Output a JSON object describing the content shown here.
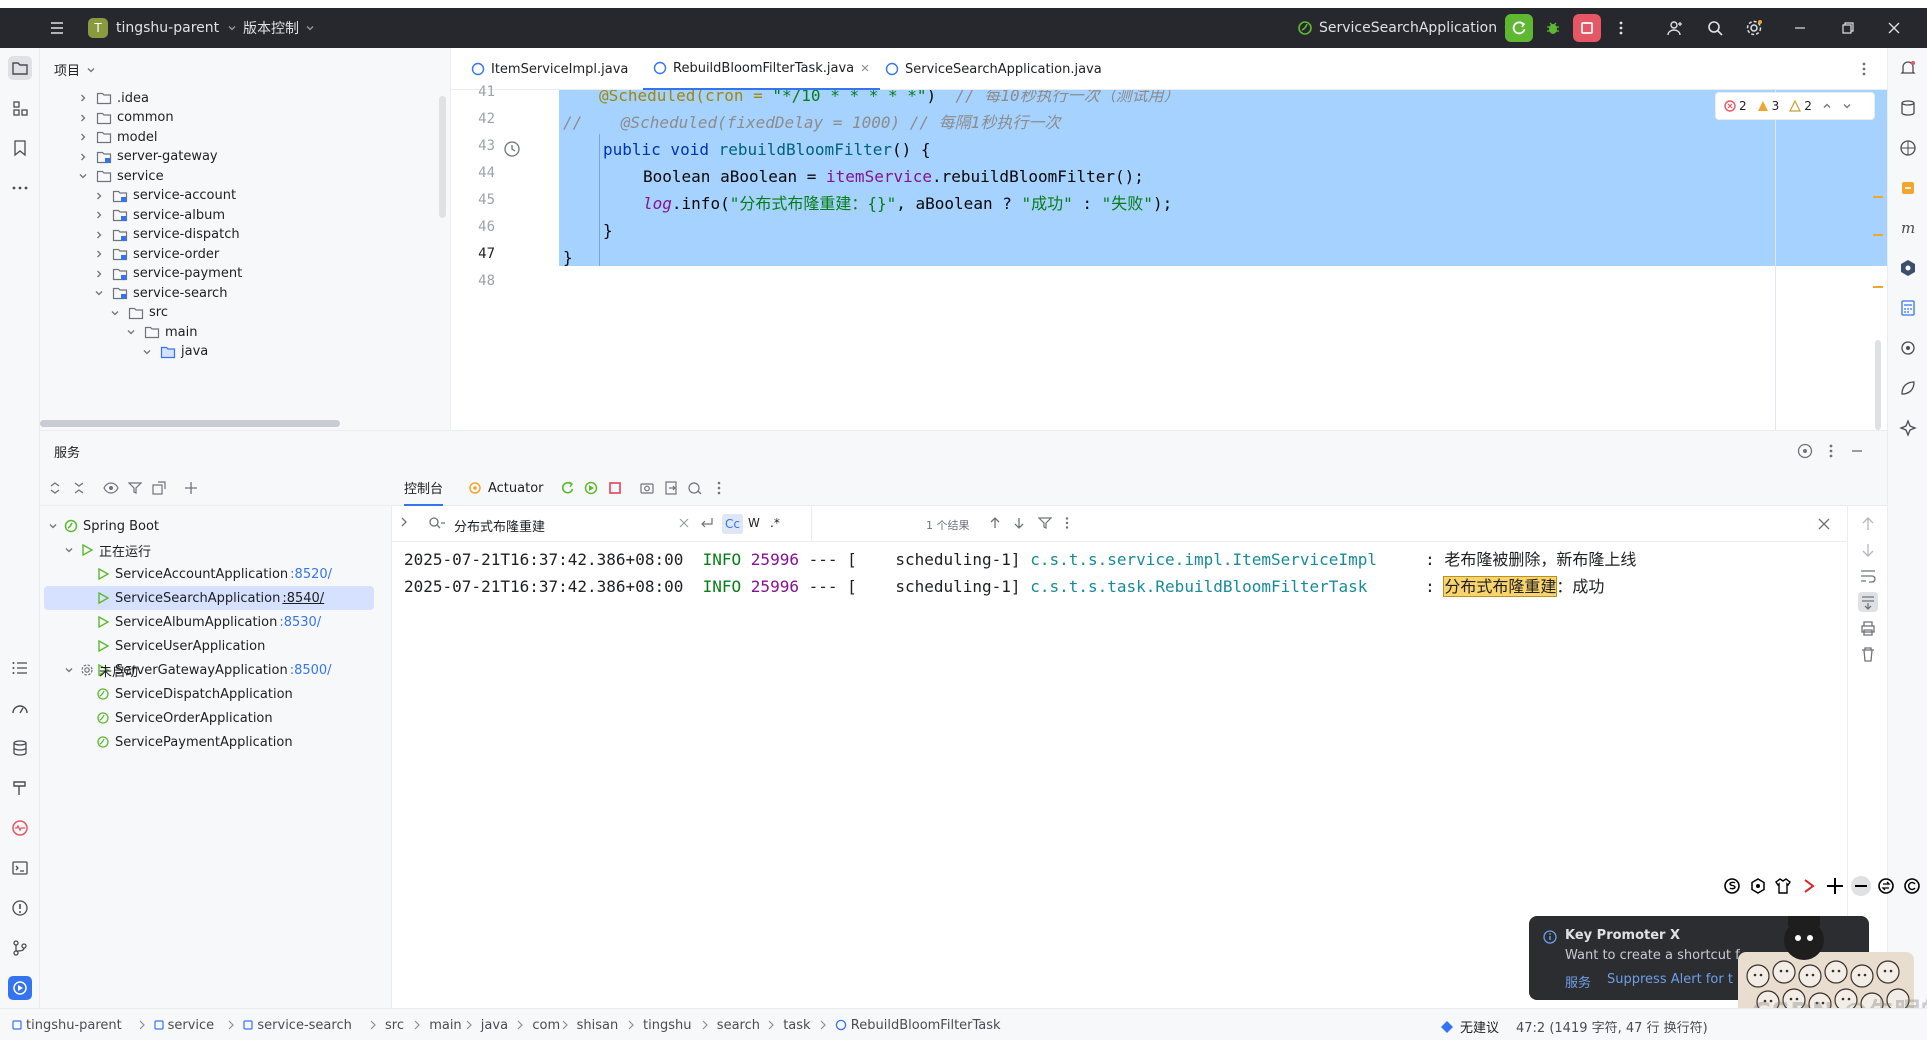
{
  "titlebar": {
    "project_initial": "T",
    "project_name": "tingshu-parent",
    "vcs_label": "版本控制",
    "run_config": "ServiceSearchApplication"
  },
  "project_panel": {
    "title": "项目",
    "tree": [
      {
        "label": ".idea",
        "level": 1,
        "expanded": false,
        "type": "folder"
      },
      {
        "label": "common",
        "level": 1,
        "expanded": false,
        "type": "folder"
      },
      {
        "label": "model",
        "level": 1,
        "expanded": false,
        "type": "folder"
      },
      {
        "label": "server-gateway",
        "level": 1,
        "expanded": false,
        "type": "module"
      },
      {
        "label": "service",
        "level": 1,
        "expanded": true,
        "type": "folder"
      },
      {
        "label": "service-account",
        "level": 2,
        "expanded": false,
        "type": "module"
      },
      {
        "label": "service-album",
        "level": 2,
        "expanded": false,
        "type": "module"
      },
      {
        "label": "service-dispatch",
        "level": 2,
        "expanded": false,
        "type": "module"
      },
      {
        "label": "service-order",
        "level": 2,
        "expanded": false,
        "type": "module"
      },
      {
        "label": "service-payment",
        "level": 2,
        "expanded": false,
        "type": "module"
      },
      {
        "label": "service-search",
        "level": 2,
        "expanded": true,
        "type": "module"
      },
      {
        "label": "src",
        "level": 3,
        "expanded": true,
        "type": "folder"
      },
      {
        "label": "main",
        "level": 4,
        "expanded": true,
        "type": "folder"
      },
      {
        "label": "java",
        "level": 5,
        "expanded": true,
        "type": "source"
      }
    ]
  },
  "editor": {
    "tabs": [
      {
        "label": "ItemServiceImpl.java",
        "active": false
      },
      {
        "label": "RebuildBloomFilterTask.java",
        "active": true
      },
      {
        "label": "ServiceSearchApplication.java",
        "active": false
      }
    ],
    "line_numbers": [
      "41",
      "42",
      "43",
      "44",
      "45",
      "46",
      "47",
      "48"
    ],
    "code": {
      "l41_anno": "@Scheduled(cron = ",
      "l41_str": "\"*/10 * * * * *\"",
      "l41_tail": ")  ",
      "l41_cmt": "// 每10秒执行一次（测试用）",
      "l42_cmt": "//    @Scheduled(fixedDelay = 1000) // 每隔1秒执行一次",
      "l43_kw": "public void ",
      "l43_fn": "rebuildBloomFilter",
      "l43_tail": "() {",
      "l44_type": "Boolean aBoolean = ",
      "l44_fld": "itemService",
      "l44_tail": ".rebuildBloomFilter();",
      "l45_log": "log",
      "l45_mid": ".info(",
      "l45_str1": "\"分布式布隆重建：{}\"",
      "l45_mid2": ", aBoolean ? ",
      "l45_str2": "\"成功\"",
      "l45_mid3": " : ",
      "l45_str3": "\"失败\"",
      "l45_end": ");",
      "l46": "}",
      "l47": "}"
    },
    "inspections": {
      "errors": "2",
      "warnings": "3",
      "weak": "2"
    }
  },
  "services_panel": {
    "title": "服务",
    "root": "Spring Boot",
    "running_group": "正在运行",
    "running": [
      {
        "name": "ServiceAccountApplication",
        "port": ":8520/",
        "selected": false
      },
      {
        "name": "ServiceSearchApplication",
        "port": ":8540/",
        "selected": true
      },
      {
        "name": "ServiceAlbumApplication",
        "port": ":8530/",
        "selected": false
      },
      {
        "name": "ServiceUserApplication",
        "port": "",
        "selected": false
      },
      {
        "name": "ServerGatewayApplication",
        "port": ":8500/",
        "selected": false
      }
    ],
    "stopped_group": "未启动",
    "stopped": [
      {
        "name": "ServiceDispatchApplication"
      },
      {
        "name": "ServiceOrderApplication"
      },
      {
        "name": "ServicePaymentApplication"
      }
    ]
  },
  "console": {
    "tab_console": "控制台",
    "tab_actuator": "Actuator",
    "search_text": "分布式布隆重建",
    "search_opt_case": "Cc",
    "search_opt_word": "W",
    "search_opt_regex": ".*",
    "match_count": "1 个结果",
    "log": [
      {
        "ts": "2025-07-21T16:37:42.386+08:00",
        "level": "INFO",
        "pid": "25996",
        "sep": "--- [",
        "thread": "   scheduling-1]",
        "logger": "c.s.t.s.service.impl.ItemServiceImpl",
        "colon": "     : ",
        "msg": "老布隆被删除，新布隆上线"
      },
      {
        "ts": "2025-07-21T16:37:42.386+08:00",
        "level": "INFO",
        "pid": "25996",
        "sep": "--- [",
        "thread": "   scheduling-1]",
        "logger": "c.s.t.s.task.RebuildBloomFilterTask",
        "colon": "      : ",
        "msg_hl": "分布式布隆重建",
        "msg_rest": "：成功"
      }
    ]
  },
  "statusbar": {
    "breadcrumb": [
      "tingshu-parent",
      "service",
      "service-search",
      "src",
      "main",
      "java",
      "com",
      "shisan",
      "tingshu",
      "search",
      "task",
      "RebuildBloomFilterTask"
    ],
    "ai_label": "无建议",
    "position": "47:2 (1419 字符, 47 行 换行符)"
  },
  "key_promoter": {
    "title": "Key Promoter X",
    "message": "Want to create a shortcut f",
    "action_services": "服务",
    "action_suppress": "Suppress Alert for t"
  },
  "watermark": "CSDN @失眠的3",
  "colors": {
    "accent": "#3574f0",
    "selection": "#a6d2ff",
    "titlebar": "#27282e",
    "run_green": "#5fb832",
    "stop_red": "#e55765",
    "search_highlight": "#f9d36b"
  }
}
